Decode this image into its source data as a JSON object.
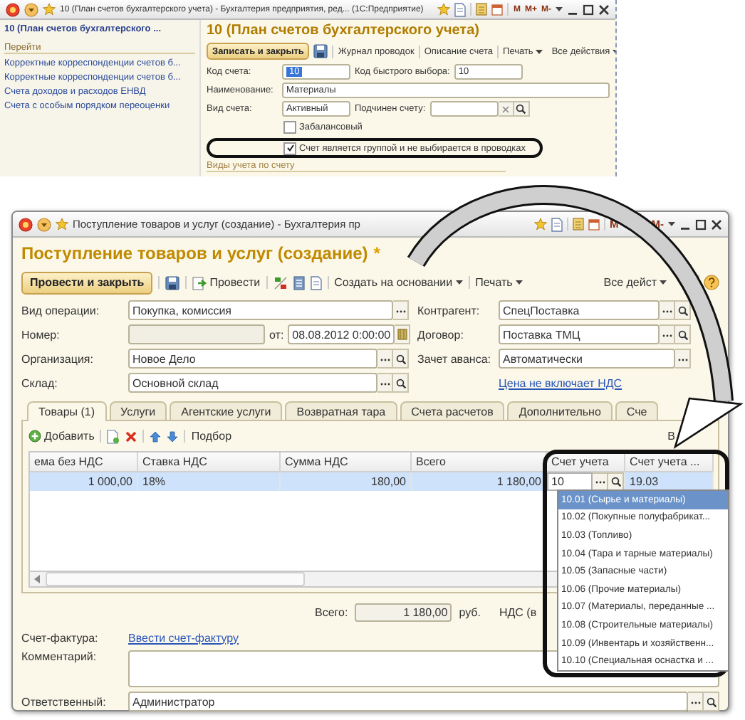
{
  "top_window": {
    "title": "10 (План счетов бухгалтерского учета) - Бухгалтерия предприятия, ред... (1С:Предприятие)",
    "title_buttons": [
      "M",
      "M+",
      "M-"
    ],
    "sidebar": {
      "title": "10 (План счетов бухгалтерского ...",
      "section": "Перейти",
      "links": [
        "Корректные корреспонденции счетов б...",
        "Корректные корреспонденции счетов б...",
        "Счета доходов и расходов ЕНВД",
        "Счета с особым порядком переоценки"
      ]
    },
    "heading": "10 (План счетов бухгалтерского учета)",
    "toolbar": {
      "primary": "Записать и закрыть",
      "items": [
        {
          "label": "Журнал проводок",
          "dropdown": false
        },
        {
          "label": "Описание счета",
          "dropdown": false
        },
        {
          "label": "Печать",
          "dropdown": true
        }
      ],
      "all_actions": "Все действия"
    },
    "rows": [
      {
        "kind": "fields",
        "fields": [
          {
            "kind": "plain",
            "label": "Код счета:",
            "value": "10",
            "text_selected": true
          },
          {
            "kind": "plain",
            "label": "Код быстрого выбора:",
            "value": "10",
            "text_selected": false
          }
        ]
      },
      {
        "kind": "fields",
        "fields": [
          {
            "kind": "plain",
            "label": "Наименование:",
            "value": "Материалы",
            "text_selected": false
          }
        ]
      },
      {
        "kind": "fields",
        "fields": [
          {
            "kind": "plain",
            "label": "Вид счета:",
            "value": "Активный",
            "text_selected": false
          },
          {
            "kind": "lookup",
            "label": "Подчинен счету:"
          }
        ]
      },
      {
        "kind": "checkbox",
        "label": "Забалансовый",
        "checked": false,
        "highlighted": false
      },
      {
        "kind": "checkbox",
        "label": "Счет является группой и не выбирается в проводках",
        "checked": true,
        "highlighted": true
      },
      {
        "kind": "group",
        "title": "Виды учета по счету"
      }
    ]
  },
  "main_window": {
    "title": "Поступление товаров и услуг (создание) - Бухгалтерия пр",
    "title_buttons": [
      "M",
      "M-"
    ],
    "heading": "Поступление товаров и услуг (создание)",
    "modified_mark": "*",
    "toolbar": {
      "primary": "Провести и закрыть",
      "post": "Провести",
      "menus": [
        "Создать на основании",
        "Печать"
      ],
      "all_actions": "Все дейст"
    },
    "form_left": [
      {
        "kind": "choice",
        "label": "Вид операции:",
        "value": "Покупка, комиссия",
        "disabled": false
      },
      {
        "kind": "date",
        "label": "Номер:",
        "disabled": true,
        "date_label": "от:",
        "date": "08.08.2012  0:00:00"
      },
      {
        "kind": "reference",
        "label": "Организация:",
        "value": "Новое Дело",
        "disabled": false
      },
      {
        "kind": "reference",
        "label": "Склад:",
        "value": "Основной склад",
        "disabled": false
      }
    ],
    "form_right": [
      {
        "kind": "reference",
        "label": "Контрагент:",
        "value": "СпецПоставка",
        "disabled": false
      },
      {
        "kind": "reference",
        "label": "Договор:",
        "value": "Поставка ТМЦ",
        "disabled": false
      },
      {
        "kind": "choice",
        "label": "Зачет аванса:",
        "value": "Автоматически",
        "disabled": false
      },
      {
        "kind": "link",
        "text": "Цена не включает НДС"
      }
    ],
    "tabs": [
      {
        "label": "Товары (1)",
        "selected": true
      },
      {
        "label": "Услуги",
        "selected": false
      },
      {
        "label": "Агентские услуги",
        "selected": false
      },
      {
        "label": "Возвратная тара",
        "selected": false
      },
      {
        "label": "Счета расчетов",
        "selected": false
      },
      {
        "label": "Дополнительно",
        "selected": false
      },
      {
        "label": "Сче",
        "selected": false
      }
    ],
    "table_toolbar": {
      "add": "Добавить",
      "pick": "Подбор",
      "all_actions": "В"
    },
    "table": {
      "columns": [
        "ема без НДС",
        "Ставка НДС",
        "Сумма НДС",
        "Всего",
        "Счет учета",
        "Счет учета ..."
      ],
      "rows": [
        {
          "selected": true,
          "cells": [
            {
              "kind": "number",
              "text": "1 000,00"
            },
            {
              "kind": "text",
              "text": "18%"
            },
            {
              "kind": "number",
              "text": "180,00"
            },
            {
              "kind": "number",
              "text": "1 180,00"
            },
            {
              "kind": "editor",
              "text": "10"
            },
            {
              "kind": "text",
              "text": "19.03"
            }
          ]
        }
      ]
    },
    "dropdown": {
      "items": [
        {
          "text": "10.01 (Сырье и материалы)",
          "selected": true
        },
        {
          "text": "10.02 (Покупные полуфабрикат...",
          "selected": false
        },
        {
          "text": "10.03 (Топливо)",
          "selected": false
        },
        {
          "text": "10.04 (Тара и тарные материалы)",
          "selected": false
        },
        {
          "text": "10.05 (Запасные части)",
          "selected": false
        },
        {
          "text": "10.06 (Прочие материалы)",
          "selected": false
        },
        {
          "text": "10.07 (Материалы, переданные ...",
          "selected": false
        },
        {
          "text": "10.08 (Строительные материалы)",
          "selected": false
        },
        {
          "text": "10.09 (Инвентарь и хозяйственн...",
          "selected": false
        },
        {
          "text": "10.10 (Специальная оснастка и ...",
          "selected": false
        }
      ]
    },
    "totals": {
      "label": "Всего:",
      "value": "1 180,00",
      "currency": "руб.",
      "vat_label": "НДС (в"
    },
    "invoice": {
      "label": "Счет-фактура:",
      "link": "Ввести счет-фактуру"
    },
    "comment": {
      "label": "Комментарий:"
    },
    "responsible": {
      "label": "Ответственный:",
      "value": "Администратор"
    }
  }
}
